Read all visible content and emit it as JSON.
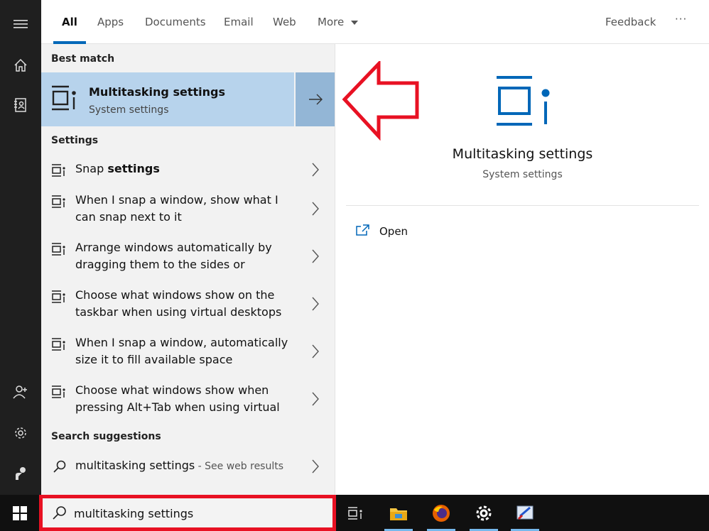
{
  "tabs": [
    {
      "label": "All"
    },
    {
      "label": "Apps"
    },
    {
      "label": "Documents"
    },
    {
      "label": "Email"
    },
    {
      "label": "Web"
    },
    {
      "label": "More"
    }
  ],
  "header": {
    "feedback": "Feedback",
    "more_options": "···"
  },
  "results": {
    "best_match_label": "Best match",
    "best_match": {
      "title": "Multitasking settings",
      "subtitle": "System settings"
    },
    "settings_label": "Settings",
    "settings": [
      {
        "pre": "Snap ",
        "bold": "settings",
        "line2": ""
      },
      {
        "pre": "When I snap a window, show what I",
        "bold": "",
        "line2": "can snap next to it"
      },
      {
        "pre": "Arrange windows automatically by",
        "bold": "",
        "line2": "dragging them to the sides or"
      },
      {
        "pre": "Choose what windows show on the",
        "bold": "",
        "line2": "taskbar when using virtual desktops"
      },
      {
        "pre": "When I snap a window, automatically",
        "bold": "",
        "line2": "size it to fill available space"
      },
      {
        "pre": "Choose what windows show when",
        "bold": "",
        "line2": "pressing Alt+Tab when using virtual"
      }
    ],
    "suggestions_label": "Search suggestions",
    "suggestion": {
      "text": "multitasking settings",
      "hint": " - See web results"
    }
  },
  "preview": {
    "title": "Multitasking settings",
    "subtitle": "System settings",
    "open_label": "Open"
  },
  "search": {
    "value": "multitasking settings"
  },
  "colors": {
    "accent": "#0067b8",
    "highlight": "#b7d3ec",
    "annotation_red": "#e81123"
  }
}
